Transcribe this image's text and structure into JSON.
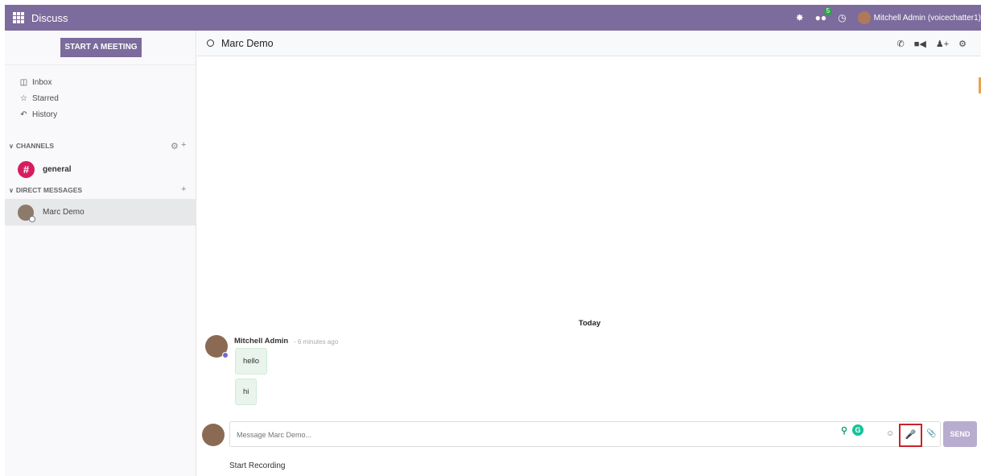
{
  "topbar": {
    "app_title": "Discuss",
    "messages_badge": "5",
    "user_name": "Mitchell Admin (voicechatter1)"
  },
  "sidebar": {
    "start_meeting": "START A MEETING",
    "mailboxes": [
      {
        "label": "Inbox",
        "icon": "inbox-icon"
      },
      {
        "label": "Starred",
        "icon": "star-icon"
      },
      {
        "label": "History",
        "icon": "history-icon"
      }
    ],
    "channels_label": "CHANNELS",
    "channel": {
      "name": "general"
    },
    "direct_messages_label": "DIRECT MESSAGES",
    "dm": {
      "name": "Marc Demo"
    }
  },
  "thread": {
    "title": "Marc Demo",
    "date_separator": "Today",
    "message": {
      "author": "Mitchell Admin",
      "time": "- 6 minutes ago",
      "bubbles": [
        "hello",
        "hi"
      ]
    }
  },
  "composer": {
    "placeholder": "Message Marc Demo...",
    "send_label": "SEND",
    "recording_label": "Start Recording"
  },
  "colors": {
    "topbar": "#7c6b9d",
    "channel_avatar": "#d81b60",
    "send_button": "#b8adcf",
    "highlight_box": "#c8232c"
  }
}
